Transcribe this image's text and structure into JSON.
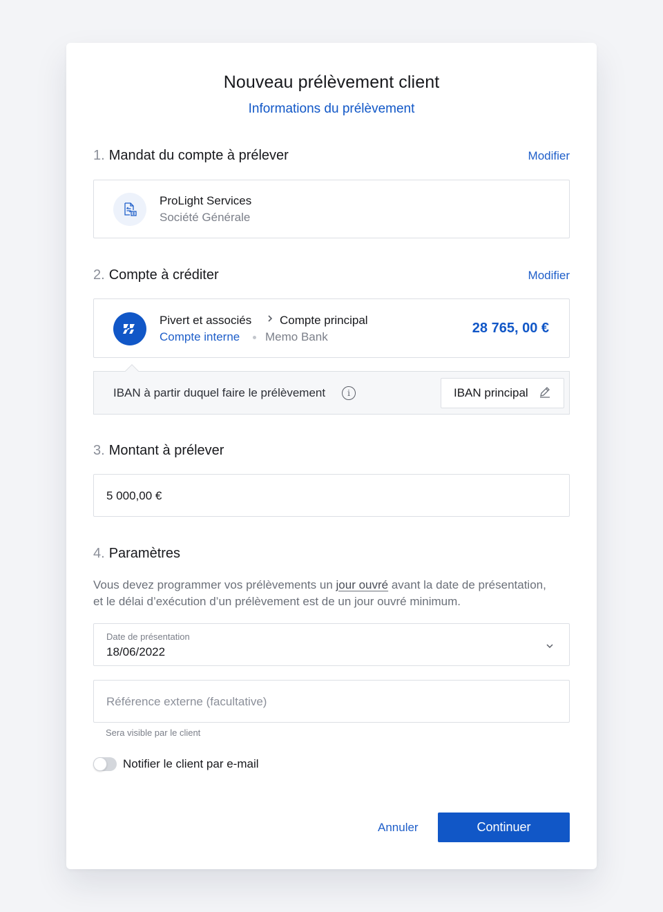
{
  "header": {
    "title": "Nouveau prélèvement client",
    "subtitle": "Informations du prélèvement"
  },
  "section1": {
    "number": "1.",
    "title": "Mandat du compte à prélever",
    "edit_label": "Modifier",
    "mandate": {
      "icon": "document-transfer-icon",
      "name": "ProLight Services",
      "bank": "Société Générale"
    }
  },
  "section2": {
    "number": "2.",
    "title": "Compte à créditer",
    "edit_label": "Modifier",
    "account": {
      "icon": "memo-bank-logo-icon",
      "owner": "Pivert et associés",
      "account_name": "Compte principal",
      "type": "Compte interne",
      "bank": "Memo Bank",
      "balance": "28 765, 00 €"
    },
    "iban": {
      "label": "IBAN à partir duquel faire le prélèvement",
      "value": "IBAN principal"
    }
  },
  "section3": {
    "number": "3.",
    "title": "Montant à prélever",
    "amount": "5 000,00 €"
  },
  "section4": {
    "number": "4.",
    "title": "Paramètres",
    "info_before": "Vous devez programmer vos prélèvements un ",
    "info_link": "jour ouvré",
    "info_after": " avant la date de présentation,",
    "info_line2": "et le délai d’exécution d’un prélèvement est de un jour ouvré minimum.",
    "date_field": {
      "label": "Date de présentation",
      "value": "18/06/2022"
    },
    "reference_field": {
      "placeholder": "Référence externe (facultative)",
      "helper": "Sera visible par le client"
    },
    "notify": {
      "label": "Notifier le client par e-mail",
      "enabled": false
    }
  },
  "footer": {
    "cancel_label": "Annuler",
    "continue_label": "Continuer"
  },
  "colors": {
    "accent": "#1157c7",
    "link": "#1e5ec9"
  }
}
